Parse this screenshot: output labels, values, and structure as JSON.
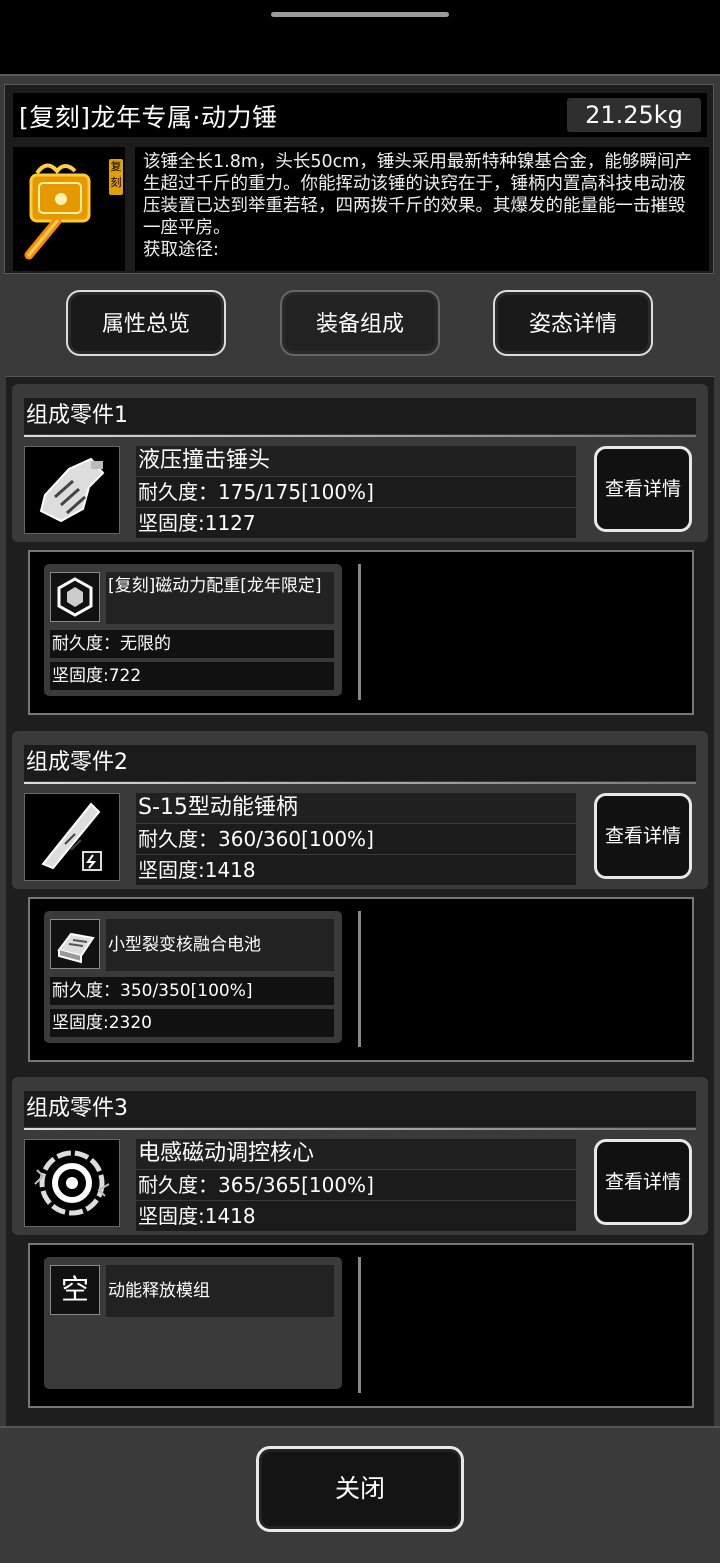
{
  "item": {
    "title": "[复刻]龙年专属·动力锤",
    "weight": "21.25kg",
    "badge": "复刻",
    "description": "该锤全长1.8m，头长50cm，锤头采用最新特种镍基合金，能够瞬间产生超过千斤的重力。你能挥动该锤的诀窍在于，锤柄内置高科技电动液压装置已达到举重若轻，四两拨千斤的效果。其爆发的能量能一击摧毁一座平房。",
    "source_label": "获取途径:",
    "icon": "power-hammer-icon"
  },
  "tabs": [
    {
      "label": "属性总览"
    },
    {
      "label": "装备组成"
    },
    {
      "label": "姿态详情"
    }
  ],
  "parts": [
    {
      "title": "组成零件1",
      "name": "液压撞击锤头",
      "durability": "耐久度：175/175[100%]",
      "hardness": "坚固度:1127",
      "button": "查看详情",
      "icon": "hammer-head-icon",
      "sub": {
        "name": "[复刻]磁动力配重[龙年限定]",
        "durability": "耐久度：无限的",
        "hardness": "坚固度:722",
        "icon": "hex-weight-icon"
      }
    },
    {
      "title": "组成零件2",
      "name": "S-15型动能锤柄",
      "durability": "耐久度：360/360[100%]",
      "hardness": "坚固度:1418",
      "button": "查看详情",
      "icon": "hammer-handle-icon",
      "sub": {
        "name": "小型裂变核融合电池",
        "durability": "耐久度：350/350[100%]",
        "hardness": "坚固度:2320",
        "icon": "battery-icon"
      }
    },
    {
      "title": "组成零件3",
      "name": "电感磁动调控核心",
      "durability": "耐久度：365/365[100%]",
      "hardness": "坚固度:1418",
      "button": "查看详情",
      "icon": "core-ring-icon",
      "sub": {
        "name": "动能释放模组",
        "empty_label": "空"
      }
    }
  ],
  "footer": {
    "close_label": "关闭"
  }
}
